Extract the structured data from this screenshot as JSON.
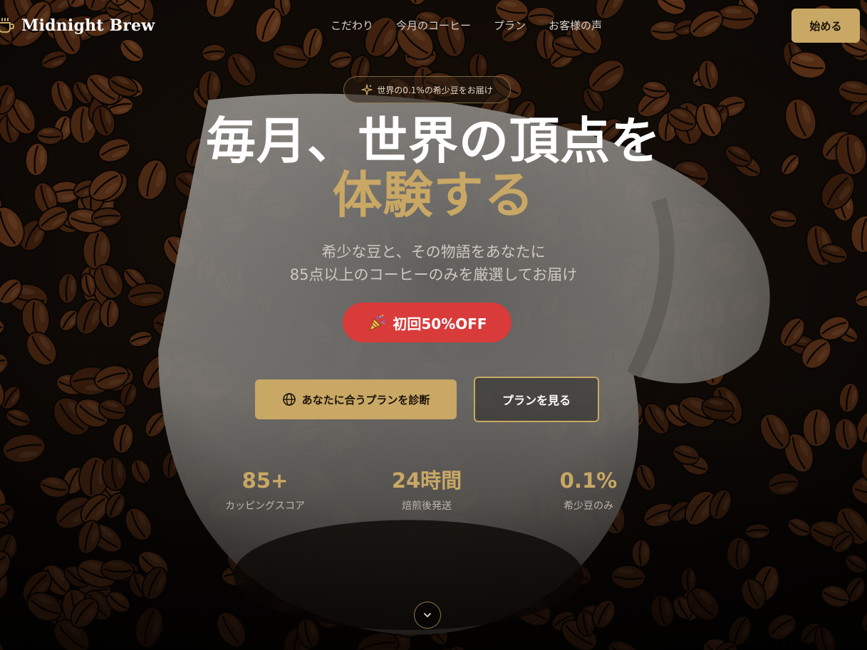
{
  "brand": {
    "name": "Midnight Brew",
    "icon": "coffee-cup-icon"
  },
  "nav": {
    "items": [
      {
        "label": "こだわり"
      },
      {
        "label": "今月のコーヒー"
      },
      {
        "label": "プラン"
      },
      {
        "label": "お客様の声"
      }
    ],
    "cta_label": "始める"
  },
  "hero": {
    "badge": {
      "icon": "sparkles-icon",
      "text": "世界の0.1%の希少豆をお届け"
    },
    "headline_line1": "毎月、世界の頂点を",
    "headline_line2": "体験する",
    "sub_line1": "希少な豆と、その物語をあなたに",
    "sub_line2": "85点以上のコーヒーのみを厳選してお届け",
    "promo": {
      "icon": "party-popper-icon",
      "text": "初回50%OFF"
    },
    "primary_cta": {
      "icon": "globe-icon",
      "label": "あなたに合うプランを診断"
    },
    "secondary_cta": {
      "label": "プランを見る"
    }
  },
  "stats": [
    {
      "value": "85+",
      "label": "カッピングスコア"
    },
    {
      "value": "24時間",
      "label": "焙煎後発送"
    },
    {
      "value": "0.1%",
      "label": "希少豆のみ"
    }
  ],
  "scroll": {
    "icon": "chevron-down-icon"
  },
  "colors": {
    "accent": "#c9a865",
    "promo": "#d93a3a",
    "background": "#0d0a08"
  }
}
